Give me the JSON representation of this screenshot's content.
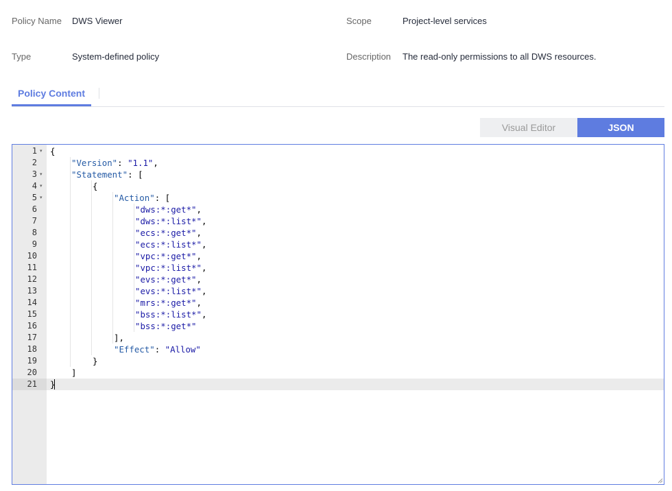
{
  "info": {
    "policy_name_label": "Policy Name",
    "policy_name_value": "DWS Viewer",
    "scope_label": "Scope",
    "scope_value": "Project-level services",
    "type_label": "Type",
    "type_value": "System-defined policy",
    "description_label": "Description",
    "description_value": "The read-only permissions to all DWS resources."
  },
  "tabs": [
    {
      "label": "Policy Content",
      "active": true
    }
  ],
  "toggle": {
    "visual_label": "Visual Editor",
    "json_label": "JSON",
    "selected": "JSON"
  },
  "editor": {
    "active_line": 21,
    "folds": [
      1,
      3,
      4,
      5
    ],
    "lines": [
      {
        "n": "1",
        "indent": 0,
        "tokens": [
          {
            "t": "p",
            "v": "{"
          }
        ]
      },
      {
        "n": "2",
        "indent": 1,
        "tokens": [
          {
            "t": "k",
            "v": "\"Version\""
          },
          {
            "t": "p",
            "v": ": "
          },
          {
            "t": "s",
            "v": "\"1.1\""
          },
          {
            "t": "p",
            "v": ","
          }
        ]
      },
      {
        "n": "3",
        "indent": 1,
        "tokens": [
          {
            "t": "k",
            "v": "\"Statement\""
          },
          {
            "t": "p",
            "v": ": ["
          }
        ]
      },
      {
        "n": "4",
        "indent": 2,
        "tokens": [
          {
            "t": "p",
            "v": "{"
          }
        ]
      },
      {
        "n": "5",
        "indent": 3,
        "tokens": [
          {
            "t": "k",
            "v": "\"Action\""
          },
          {
            "t": "p",
            "v": ": ["
          }
        ]
      },
      {
        "n": "6",
        "indent": 4,
        "tokens": [
          {
            "t": "s",
            "v": "\"dws:*:get*\""
          },
          {
            "t": "p",
            "v": ","
          }
        ]
      },
      {
        "n": "7",
        "indent": 4,
        "tokens": [
          {
            "t": "s",
            "v": "\"dws:*:list*\""
          },
          {
            "t": "p",
            "v": ","
          }
        ]
      },
      {
        "n": "8",
        "indent": 4,
        "tokens": [
          {
            "t": "s",
            "v": "\"ecs:*:get*\""
          },
          {
            "t": "p",
            "v": ","
          }
        ]
      },
      {
        "n": "9",
        "indent": 4,
        "tokens": [
          {
            "t": "s",
            "v": "\"ecs:*:list*\""
          },
          {
            "t": "p",
            "v": ","
          }
        ]
      },
      {
        "n": "10",
        "indent": 4,
        "tokens": [
          {
            "t": "s",
            "v": "\"vpc:*:get*\""
          },
          {
            "t": "p",
            "v": ","
          }
        ]
      },
      {
        "n": "11",
        "indent": 4,
        "tokens": [
          {
            "t": "s",
            "v": "\"vpc:*:list*\""
          },
          {
            "t": "p",
            "v": ","
          }
        ]
      },
      {
        "n": "12",
        "indent": 4,
        "tokens": [
          {
            "t": "s",
            "v": "\"evs:*:get*\""
          },
          {
            "t": "p",
            "v": ","
          }
        ]
      },
      {
        "n": "13",
        "indent": 4,
        "tokens": [
          {
            "t": "s",
            "v": "\"evs:*:list*\""
          },
          {
            "t": "p",
            "v": ","
          }
        ]
      },
      {
        "n": "14",
        "indent": 4,
        "tokens": [
          {
            "t": "s",
            "v": "\"mrs:*:get*\""
          },
          {
            "t": "p",
            "v": ","
          }
        ]
      },
      {
        "n": "15",
        "indent": 4,
        "tokens": [
          {
            "t": "s",
            "v": "\"bss:*:list*\""
          },
          {
            "t": "p",
            "v": ","
          }
        ]
      },
      {
        "n": "16",
        "indent": 4,
        "tokens": [
          {
            "t": "s",
            "v": "\"bss:*:get*\""
          }
        ]
      },
      {
        "n": "17",
        "indent": 3,
        "tokens": [
          {
            "t": "p",
            "v": "],"
          }
        ]
      },
      {
        "n": "18",
        "indent": 3,
        "tokens": [
          {
            "t": "k",
            "v": "\"Effect\""
          },
          {
            "t": "p",
            "v": ": "
          },
          {
            "t": "s",
            "v": "\"Allow\""
          }
        ]
      },
      {
        "n": "19",
        "indent": 2,
        "tokens": [
          {
            "t": "p",
            "v": "}"
          }
        ]
      },
      {
        "n": "20",
        "indent": 1,
        "tokens": [
          {
            "t": "p",
            "v": "]"
          }
        ]
      },
      {
        "n": "21",
        "indent": 0,
        "tokens": [
          {
            "t": "p",
            "v": "}"
          }
        ]
      }
    ]
  }
}
